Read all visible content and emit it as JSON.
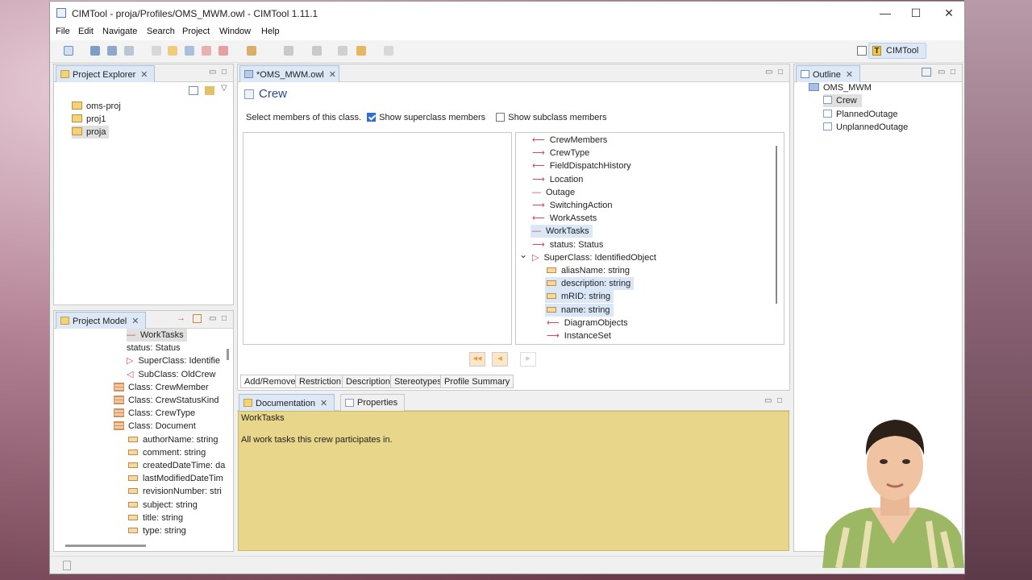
{
  "window": {
    "title": "CIMTool - proja/Profiles/OMS_MWM.owl - CIMTool 1.11.1",
    "minimize": "—",
    "maximize": "☐",
    "close": "✕"
  },
  "menu": [
    "File",
    "Edit",
    "Navigate",
    "Search",
    "Project",
    "Window",
    "Help"
  ],
  "perspective": {
    "label": "CIMTool"
  },
  "project_explorer": {
    "tab": "Project Explorer",
    "items": [
      "oms-proj",
      "proj1",
      "proja"
    ]
  },
  "project_model": {
    "tab": "Project Model",
    "items": [
      {
        "label": "WorkTasks",
        "kind": "plain",
        "sel": true
      },
      {
        "label": "status: Status",
        "kind": "ref"
      },
      {
        "label": "SuperClass: Identifie",
        "kind": "super"
      },
      {
        "label": "SubClass: OldCrew",
        "kind": "sub"
      },
      {
        "label": "Class: CrewMember",
        "kind": "class"
      },
      {
        "label": "Class: CrewStatusKind",
        "kind": "class"
      },
      {
        "label": "Class: CrewType",
        "kind": "class"
      },
      {
        "label": "Class: Document",
        "kind": "class"
      },
      {
        "label": "authorName: string",
        "kind": "attr"
      },
      {
        "label": "comment: string",
        "kind": "attr"
      },
      {
        "label": "createdDateTime: da",
        "kind": "attr"
      },
      {
        "label": "lastModifiedDateTim",
        "kind": "attr"
      },
      {
        "label": "revisionNumber: stri",
        "kind": "attr"
      },
      {
        "label": "subject: string",
        "kind": "attr"
      },
      {
        "label": "title: string",
        "kind": "attr"
      },
      {
        "label": "type: string",
        "kind": "attr"
      }
    ]
  },
  "editor": {
    "tab": "*OMS_MWM.owl",
    "class_name": "Crew",
    "instruction": "Select members of this class.",
    "show_superclass": "Show superclass members",
    "show_subclass": "Show subclass members",
    "members": [
      {
        "label": "CrewMembers",
        "kind": "left"
      },
      {
        "label": "CrewType",
        "kind": "right"
      },
      {
        "label": "FieldDispatchHistory",
        "kind": "left"
      },
      {
        "label": "Location",
        "kind": "right"
      },
      {
        "label": "Outage",
        "kind": "plain"
      },
      {
        "label": "SwitchingAction",
        "kind": "right"
      },
      {
        "label": "WorkAssets",
        "kind": "left"
      },
      {
        "label": "WorkTasks",
        "kind": "plain",
        "sel": true
      },
      {
        "label": "status: Status",
        "kind": "right"
      },
      {
        "label": "SuperClass: IdentifiedObject",
        "kind": "super"
      },
      {
        "label": "aliasName: string",
        "kind": "attr",
        "indent": true
      },
      {
        "label": "description: string",
        "kind": "attr",
        "indent": true,
        "sel": true
      },
      {
        "label": "mRID: string",
        "kind": "attr",
        "indent": true,
        "sel": true
      },
      {
        "label": "name: string",
        "kind": "attr",
        "indent": true,
        "sel": true
      },
      {
        "label": "DiagramObjects",
        "kind": "left",
        "indent": true
      },
      {
        "label": "InstanceSet",
        "kind": "right",
        "indent": true
      }
    ],
    "bottom_tabs": [
      "Add/Remove",
      "Restriction",
      "Description",
      "Stereotypes",
      "Profile Summary"
    ]
  },
  "outline": {
    "tab": "Outline",
    "root": "OMS_MWM",
    "items": [
      "Crew",
      "PlannedOutage",
      "UnplannedOutage"
    ]
  },
  "documentation": {
    "tab": "Documentation",
    "properties_tab": "Properties",
    "heading": "WorkTasks",
    "text": "All work tasks this crew participates in."
  }
}
